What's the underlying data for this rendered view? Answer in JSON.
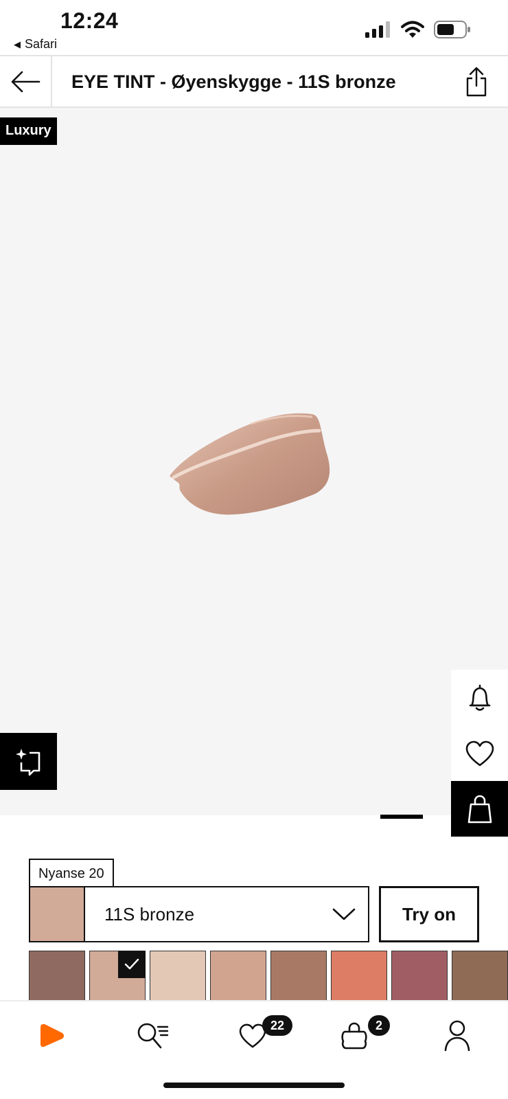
{
  "status_bar": {
    "time": "12:24",
    "back_app": "Safari",
    "back_arrow": "◀"
  },
  "header": {
    "title": "EYE TINT - Øyenskygge - 11S bronze"
  },
  "product": {
    "badge": "Luxury"
  },
  "shade_selector": {
    "label": "Nyanse 20",
    "selected_shade": "11S bronze",
    "selected_color": "#d2aa98",
    "try_on_label": "Try on",
    "shades": [
      {
        "color": "#8f6a60",
        "selected": false
      },
      {
        "color": "#d2aa98",
        "selected": true
      },
      {
        "color": "#e3c8b5",
        "selected": false
      },
      {
        "color": "#d1a48f",
        "selected": false
      },
      {
        "color": "#a87a66",
        "selected": false
      },
      {
        "color": "#dd7d65",
        "selected": false
      },
      {
        "color": "#a05e64",
        "selected": false
      },
      {
        "color": "#8f6a55",
        "selected": false
      }
    ]
  },
  "tab_bar": {
    "wishlist_count": "22",
    "cart_count": "2",
    "brand_color": "#ff6900"
  }
}
